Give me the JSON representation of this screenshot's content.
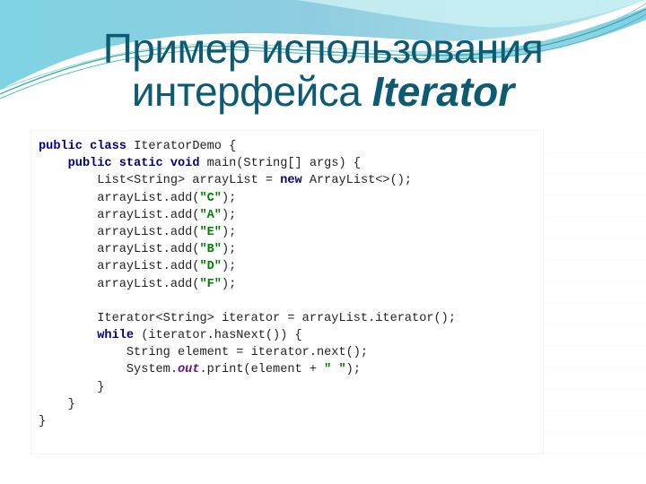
{
  "slide": {
    "title_line1": "Пример использования",
    "title_line2_prefix": "интерфейса ",
    "title_line2_emphasis": "Iterator",
    "colors": {
      "title": "#0d5a73",
      "keyword": "#000080",
      "string": "#008000",
      "field": "#660e7a",
      "code_text": "#222222"
    }
  },
  "code": {
    "lines": [
      [
        {
          "t": "kw",
          "v": "public class"
        },
        {
          "t": "txt",
          "v": " IteratorDemo {"
        }
      ],
      [
        {
          "t": "txt",
          "v": "    "
        },
        {
          "t": "kw",
          "v": "public static void"
        },
        {
          "t": "txt",
          "v": " main(String[] args) {"
        }
      ],
      [
        {
          "t": "txt",
          "v": "        List<String> arrayList = "
        },
        {
          "t": "kw",
          "v": "new"
        },
        {
          "t": "txt",
          "v": " ArrayList<>();"
        }
      ],
      [
        {
          "t": "txt",
          "v": "        arrayList.add("
        },
        {
          "t": "str",
          "v": "\"C\""
        },
        {
          "t": "txt",
          "v": ");"
        }
      ],
      [
        {
          "t": "txt",
          "v": "        arrayList.add("
        },
        {
          "t": "str",
          "v": "\"A\""
        },
        {
          "t": "txt",
          "v": ");"
        }
      ],
      [
        {
          "t": "txt",
          "v": "        arrayList.add("
        },
        {
          "t": "str",
          "v": "\"E\""
        },
        {
          "t": "txt",
          "v": ");"
        }
      ],
      [
        {
          "t": "txt",
          "v": "        arrayList.add("
        },
        {
          "t": "str",
          "v": "\"B\""
        },
        {
          "t": "txt",
          "v": ");"
        }
      ],
      [
        {
          "t": "txt",
          "v": "        arrayList.add("
        },
        {
          "t": "str",
          "v": "\"D\""
        },
        {
          "t": "txt",
          "v": ");"
        }
      ],
      [
        {
          "t": "txt",
          "v": "        arrayList.add("
        },
        {
          "t": "str",
          "v": "\"F\""
        },
        {
          "t": "txt",
          "v": ");"
        }
      ],
      [
        {
          "t": "txt",
          "v": ""
        }
      ],
      [
        {
          "t": "txt",
          "v": "        Iterator<String> iterator = arrayList.iterator();"
        }
      ],
      [
        {
          "t": "txt",
          "v": "        "
        },
        {
          "t": "kw",
          "v": "while"
        },
        {
          "t": "txt",
          "v": " (iterator.hasNext()) {"
        }
      ],
      [
        {
          "t": "txt",
          "v": "            String element = iterator.next();"
        }
      ],
      [
        {
          "t": "txt",
          "v": "            System."
        },
        {
          "t": "fld",
          "v": "out"
        },
        {
          "t": "txt",
          "v": ".print(element + "
        },
        {
          "t": "str",
          "v": "\" \""
        },
        {
          "t": "txt",
          "v": ");"
        }
      ],
      [
        {
          "t": "txt",
          "v": "        }"
        }
      ],
      [
        {
          "t": "txt",
          "v": "    }"
        }
      ],
      [
        {
          "t": "txt",
          "v": "}"
        }
      ]
    ]
  }
}
